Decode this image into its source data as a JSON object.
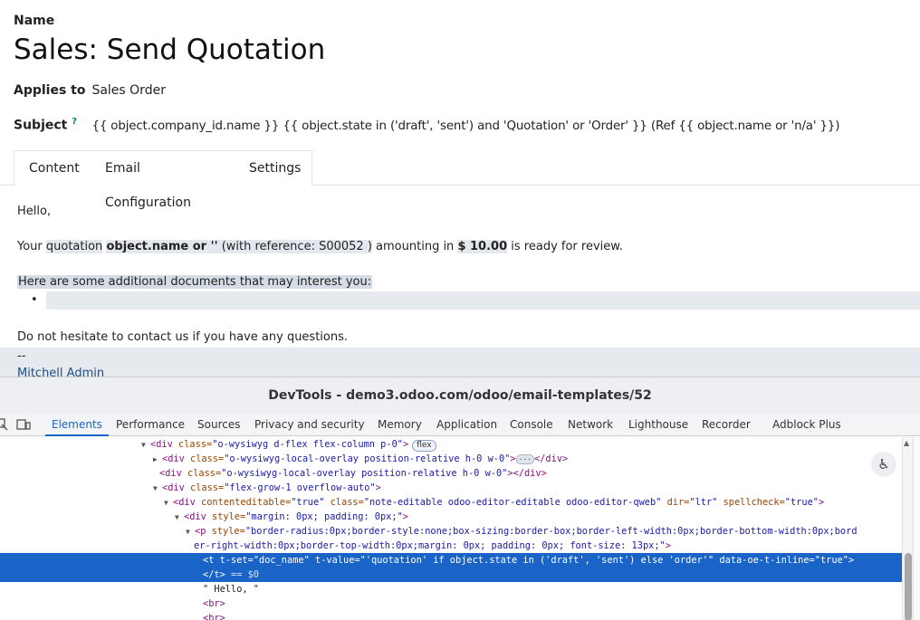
{
  "form": {
    "name_label": "Name",
    "record_title": "Sales: Send Quotation",
    "applies_to_label": "Applies to",
    "applies_to_value": "Sales Order",
    "subject_label": "Subject",
    "subject_help": "?",
    "subject_value": "{{ object.company_id.name }} {{ object.state in ('draft', 'sent') and 'Quotation' or 'Order' }} (Ref {{ object.name or 'n/a' }})"
  },
  "tabs": [
    {
      "label": "Content",
      "active": true
    },
    {
      "label": "Email Configuration",
      "active": false
    },
    {
      "label": "Settings",
      "active": false
    }
  ],
  "body": {
    "greeting": "Hello,",
    "p2_prefix": "Your ",
    "p2_quotation": "quotation",
    "p2_name": "object.name or ''",
    "p2_ref_prefix": " (with reference: ",
    "p2_ref": "S00052",
    "p2_ref_suffix": " )",
    "p2_amount_prefix": " amounting in ",
    "p2_amount": "$ 10.00",
    "p2_suffix": " is ready for review.",
    "docs_line": "Here are some additional documents that may interest you:",
    "bullet": "•",
    "contact_line": "Do not hesitate to contact us if you have any questions.",
    "sig_dash": "--",
    "sig_name": "Mitchell Admin"
  },
  "devtools": {
    "title": "DevTools - demo3.odoo.com/odoo/email-templates/52",
    "panels": [
      "Elements",
      "Performance",
      "Sources",
      "Privacy and security",
      "Memory",
      "Application",
      "Console",
      "Network",
      "Lighthouse",
      "Recorder",
      "Adblock Plus"
    ],
    "active_panel": "Elements",
    "tree": {
      "l1_open": "<div ",
      "l1_attr": "class=",
      "l1_val": "\"o-wysiwyg d-flex flex-column p-0\"",
      "l1_close": ">",
      "l1_badge": "flex",
      "l2_open": "<div ",
      "l2_attr": "class=",
      "l2_val": "\"o-wysiwyg-local-overlay position-relative h-0 w-0\"",
      "l2_mid": ">",
      "l2_ellip": "···",
      "l2_end": "</div>",
      "l3_open": "<div ",
      "l3_attr": "class=",
      "l3_val": "\"o-wysiwyg-local-overlay position-relative h-0 w-0\"",
      "l3_end": "></div>",
      "l4_open": "<div ",
      "l4_attr": "class=",
      "l4_val": "\"flex-grow-1 overflow-auto\"",
      "l4_close": ">",
      "l5_open": "<div ",
      "l5_a1": "contenteditable=",
      "l5_v1": "\"true\"",
      "l5_a2": " class=",
      "l5_v2": "\"note-editable odoo-editor-editable odoo-editor-qweb\"",
      "l5_a3": " dir=",
      "l5_v3": "\"ltr\"",
      "l5_a4": " spellcheck=",
      "l5_v4": "\"true\"",
      "l5_close": ">",
      "l6_open": "<div ",
      "l6_attr": "style=",
      "l6_val": "\"margin: 0px; padding: 0px;\"",
      "l6_close": ">",
      "l7_open": "<p ",
      "l7_attr": "style=",
      "l7_val": "\"border-radius:0px;border-style:none;box-sizing:border-box;border-left-width:0px;border-bottom-width:0px;bord",
      "l8_val": "er-right-width:0px;border-top-width:0px;margin: 0px; padding: 0px; font-size: 13px;\"",
      "l8_close": ">",
      "l9_open": "<t ",
      "l9_a1": "t-set=",
      "l9_v1": "\"doc_name\"",
      "l9_a2": " t-value=",
      "l9_v2": "\"'quotation' if object.state in ('draft', 'sent') else 'order'\"",
      "l9_a3": " data-oe-t-inline=",
      "l9_v3": "\"true\"",
      "l9_close": ">",
      "l10_tag": "</t>",
      "l10_eq": " == $0",
      "l11_text": "\" Hello, \"",
      "l12_tag": "<br>",
      "l13_tag": "<br>"
    }
  }
}
